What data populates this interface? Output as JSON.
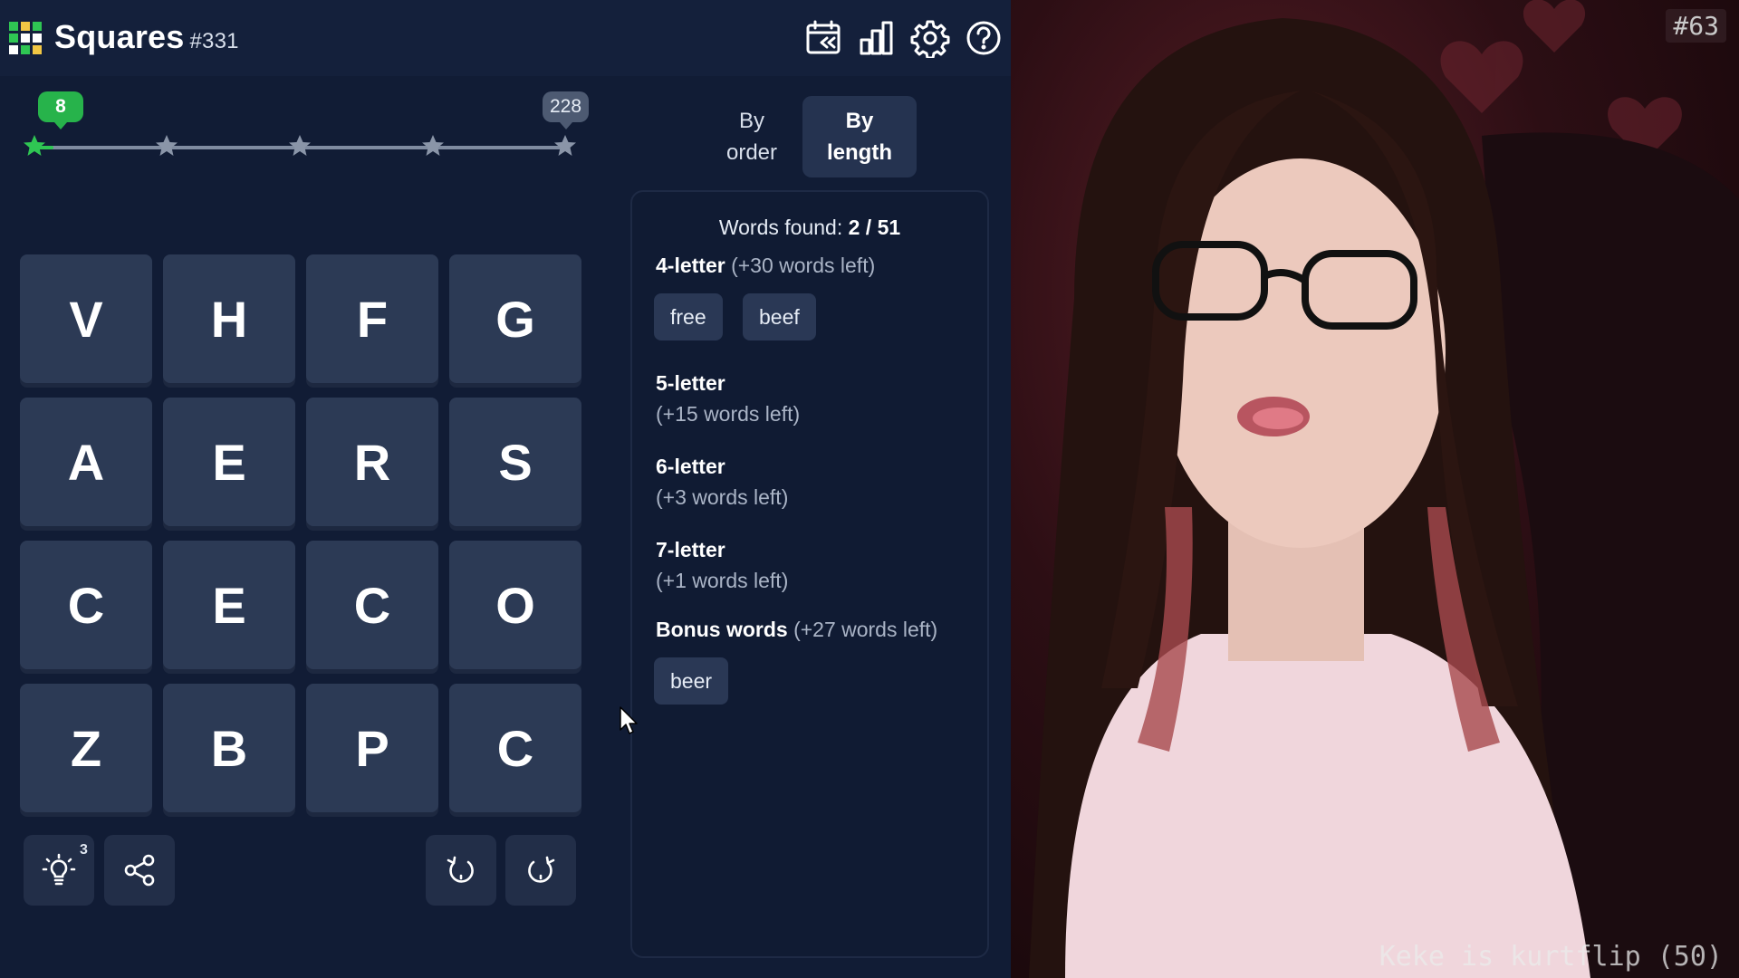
{
  "header": {
    "title": "Squares",
    "puzzle_number": "#331",
    "icons": [
      "calendar-history-icon",
      "stats-chart-icon",
      "settings-gear-icon",
      "help-icon"
    ]
  },
  "progress": {
    "current_score": "8",
    "max_score": "228",
    "fraction": 0.035,
    "milestones": 5
  },
  "grid": {
    "rows": [
      [
        "V",
        "H",
        "F",
        "G"
      ],
      [
        "A",
        "E",
        "R",
        "S"
      ],
      [
        "C",
        "E",
        "C",
        "O"
      ],
      [
        "Z",
        "B",
        "P",
        "C"
      ]
    ]
  },
  "tools": {
    "hint_count": "3",
    "icons": [
      "hint-lightbulb-icon",
      "share-icon",
      "rotate-left-icon",
      "rotate-right-icon"
    ]
  },
  "sort": {
    "order_line1": "By",
    "order_line2": "order",
    "length_line1": "By",
    "length_line2": "length",
    "active": "length"
  },
  "words": {
    "found_label": "Words found:",
    "found_value": "2 / 51",
    "categories": [
      {
        "name": "4-letter",
        "left": "(+30 words left)",
        "words": [
          "free",
          "beef"
        ]
      },
      {
        "name": "5-letter",
        "left": "(+15 words left)",
        "words": []
      },
      {
        "name": "6-letter",
        "left": "(+3 words left)",
        "words": []
      },
      {
        "name": "7-letter",
        "left": "(+1 words left)",
        "words": []
      },
      {
        "name": "Bonus words",
        "left": "(+27 words left)",
        "words": [
          "beer"
        ]
      }
    ]
  },
  "stream": {
    "overlay_number": "#63",
    "ticker": "Keke is kurtflip (50)"
  },
  "colors": {
    "background": "#111c35",
    "tile": "#2c3a55",
    "accent_green": "#2fc653",
    "chip": "#2a3855"
  }
}
